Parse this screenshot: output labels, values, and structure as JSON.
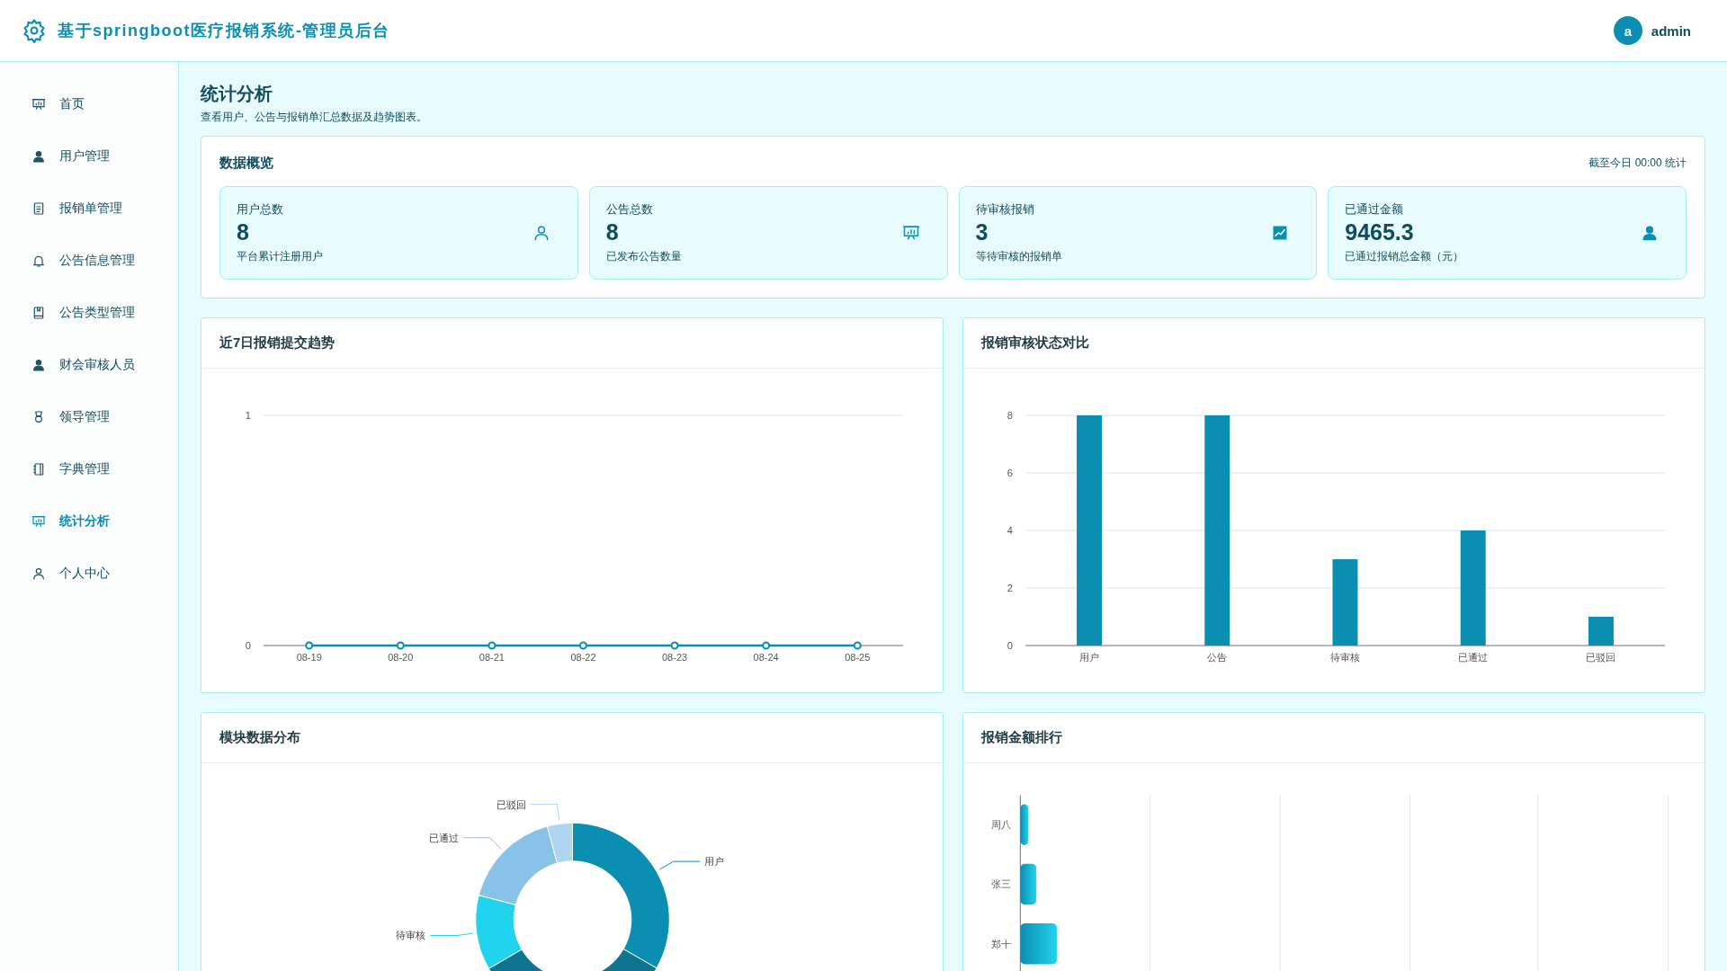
{
  "header": {
    "title": "基于springboot医疗报销系统-管理员后台",
    "user": {
      "avatar": "a",
      "name": "admin"
    }
  },
  "sidebar": {
    "items": [
      {
        "label": "首页",
        "selected": false
      },
      {
        "label": "用户管理",
        "selected": false
      },
      {
        "label": "报销单管理",
        "selected": false
      },
      {
        "label": "公告信息管理",
        "selected": false
      },
      {
        "label": "公告类型管理",
        "selected": false
      },
      {
        "label": "财会审核人员",
        "selected": false
      },
      {
        "label": "领导管理",
        "selected": false
      },
      {
        "label": "字典管理",
        "selected": false
      },
      {
        "label": "统计分析",
        "selected": true
      },
      {
        "label": "个人中心",
        "selected": false
      }
    ]
  },
  "page": {
    "title": "统计分析",
    "subtitle": "查看用户、公告与报销单汇总数据及趋势图表。"
  },
  "overview": {
    "title": "数据概览",
    "note": "截至今日 00:00 统计",
    "cards": [
      {
        "label": "用户总数",
        "value": "8",
        "caption": "平台累计注册用户"
      },
      {
        "label": "公告总数",
        "value": "8",
        "caption": "已发布公告数量"
      },
      {
        "label": "待审核报销",
        "value": "3",
        "caption": "等待审核的报销单"
      },
      {
        "label": "已通过金额",
        "value": "9465.3",
        "caption": "已通过报销总金额（元）"
      }
    ]
  },
  "trend": {
    "title": "近7日报销提交趋势",
    "chart_data": {
      "type": "line",
      "categories": [
        "08-19",
        "08-20",
        "08-21",
        "08-22",
        "08-23",
        "08-24",
        "08-25"
      ],
      "series": [
        {
          "color": "#0a8fb3",
          "values": [
            0,
            0,
            0,
            0,
            0,
            0,
            0
          ],
          "marker": "circle"
        }
      ],
      "ylim": [
        0,
        1
      ],
      "yticks": [
        0,
        1
      ],
      "grid": true
    }
  },
  "status": {
    "title": "报销审核状态对比",
    "chart_data": {
      "type": "bar",
      "categories": [
        "用户",
        "公告",
        "待审核",
        "已通过",
        "已驳回"
      ],
      "series": [
        {
          "color": "#0a8fb3",
          "values": [
            8,
            8,
            3,
            4,
            1
          ]
        }
      ],
      "ylim": [
        0,
        8
      ],
      "yticks": [
        0,
        2,
        4,
        6,
        8
      ],
      "grid": true
    }
  },
  "distribution": {
    "title": "模块数据分布",
    "chart_data": {
      "type": "donut",
      "categories": [
        "用户",
        null,
        "待审核",
        "已通过",
        "已驳回"
      ],
      "values": [
        33.3,
        33.3,
        12.5,
        16.7,
        4.2
      ],
      "colors": [
        "#0a8fb3",
        "#0e7490",
        "#22d3ee",
        "#89c2e8",
        "#aed6f1"
      ]
    }
  },
  "ranking": {
    "title": "报销金额排行",
    "labels": [
      "周八",
      "张三",
      "郑十"
    ]
  }
}
